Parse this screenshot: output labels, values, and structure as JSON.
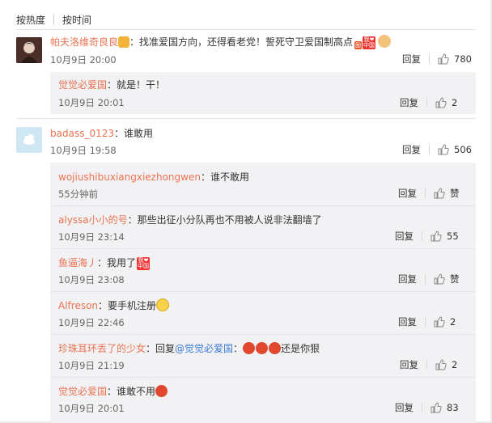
{
  "sort": {
    "hot": "按热度",
    "time": "按时间"
  },
  "actions": {
    "reply": "回复"
  },
  "comments": [
    {
      "user": "帕夫洛维奇良良",
      "text": "：找准爱国方向，还得看老党！誓死守卫爱国制高点",
      "time": "10月9日 20:00",
      "likes": "780"
    },
    {
      "user": "badass_0123",
      "text": "：谁敢用",
      "time": "10月9日 19:58",
      "likes": "506"
    }
  ],
  "replies_a": [
    {
      "user": "觉觉必爱国",
      "text": "：就是！干！",
      "time": "10月9日 20:01",
      "likes": "2"
    }
  ],
  "replies_b": [
    {
      "user": "wojiushibuxiangxiezhongwen",
      "text": "：谁不敢用",
      "time": "55分钟前",
      "likes": "赞"
    },
    {
      "user": "alyssa小小的号",
      "text": "：那些出征小分队再也不用被人说非法翻墙了",
      "time": "10月9日 23:14",
      "likes": "55"
    },
    {
      "user": "鱼逼海丿",
      "text": "：我用了",
      "time": "10月9日 23:08",
      "likes": "赞"
    },
    {
      "user": "Alfreson",
      "text": "：要手机注册",
      "time": "10月9日 22:46",
      "likes": "2"
    },
    {
      "user": "珍珠耳环丢了的少女",
      "text_prefix": "：回复",
      "mention": "@觉觉必爱国",
      "text_suffix": "：",
      "text_end": "还是你狠",
      "time": "10月9日 21:19",
      "likes": "2"
    },
    {
      "user": "觉觉必爱国",
      "text": "：谁敢不用",
      "time": "10月9日 20:01",
      "likes": "83"
    }
  ],
  "badges": {
    "li": "励",
    "wo_ai": "我❤",
    "zhong_guo": "中国"
  },
  "colors": {
    "name": "#eb7350",
    "mention": "#3a7ad8",
    "subbox": "#f2f2f5"
  }
}
